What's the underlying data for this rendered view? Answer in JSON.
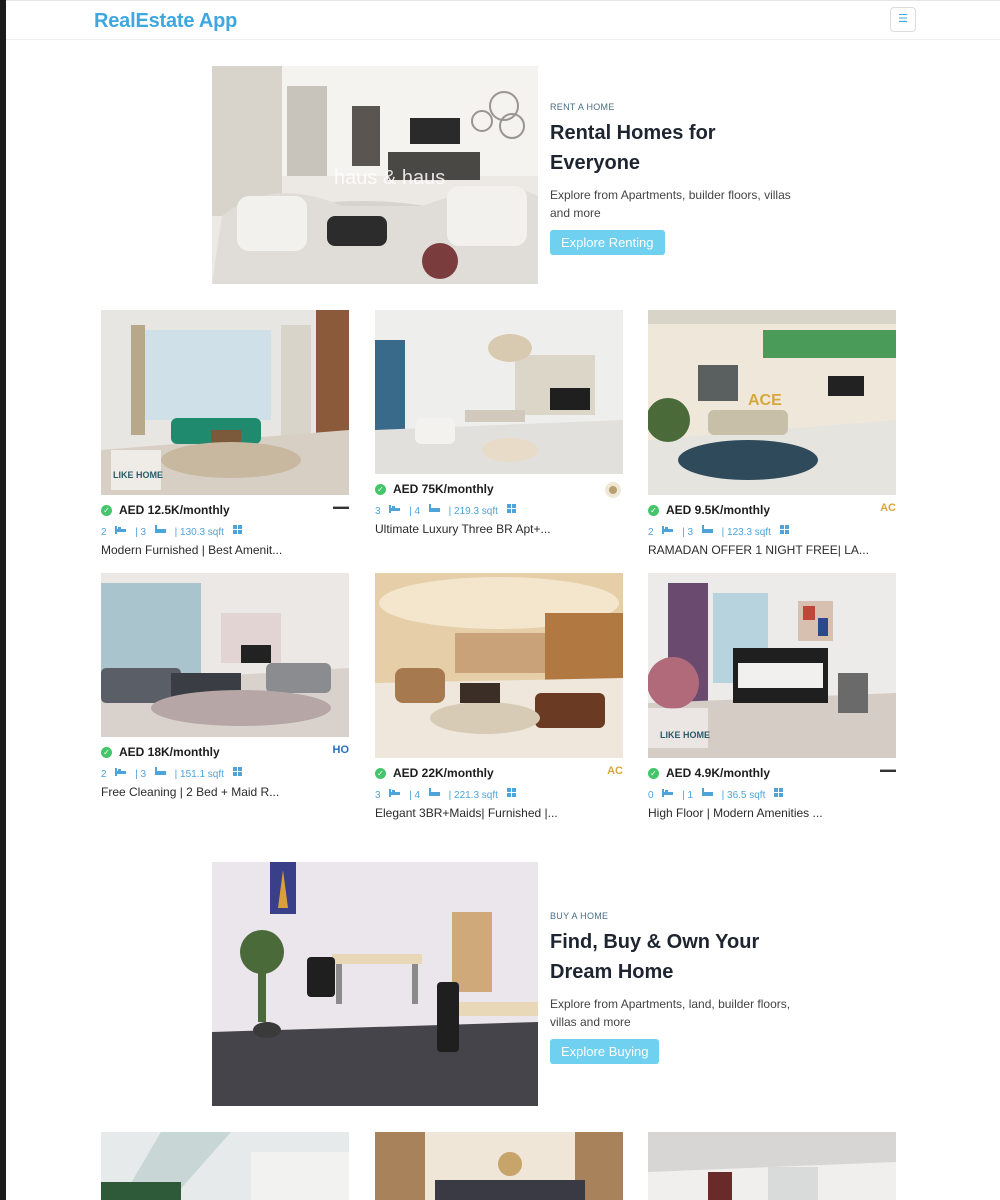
{
  "app": {
    "brand": "RealEstate App",
    "menu_icon": "hamburger-menu-icon"
  },
  "rent_section": {
    "eyebrow": "RENT A HOME",
    "title": "Rental Homes for Everyone",
    "description": "Explore from Apartments, builder floors, villas and more",
    "button": "Explore Renting",
    "image_watermark": "haus & haus"
  },
  "buy_section": {
    "eyebrow": "BUY A HOME",
    "title": "Find, Buy & Own Your Dream Home",
    "description": "Explore from Apartments, land, builder floors, villas and more",
    "button": "Explore Buying"
  },
  "listings": [
    {
      "price": "AED 12.5K/monthly",
      "beds": "2",
      "baths": "| 3",
      "area": "| 130.3 sqft",
      "title": "Modern Furnished | Best Amenit...",
      "agency_logo": "",
      "photo_watermark": "LIKE HOME"
    },
    {
      "price": "AED 75K/monthly",
      "beds": "3",
      "baths": "| 4",
      "area": "| 219.3 sqft",
      "title": "Ultimate Luxury Three BR Apt+...",
      "agency_logo": "",
      "photo_watermark": ""
    },
    {
      "price": "AED 9.5K/monthly",
      "beds": "2",
      "baths": "| 3",
      "area": "| 123.3 sqft",
      "title": "RAMADAN OFFER 1 NIGHT FREE| LA...",
      "agency_logo": "AC",
      "photo_watermark": "ACE"
    },
    {
      "price": "AED 18K/monthly",
      "beds": "2",
      "baths": "| 3",
      "area": "| 151.1 sqft",
      "title": "Free Cleaning | 2 Bed + Maid R...",
      "agency_logo": "HO",
      "photo_watermark": ""
    },
    {
      "price": "AED 22K/monthly",
      "beds": "3",
      "baths": "| 4",
      "area": "| 221.3 sqft",
      "title": "Elegant 3BR+Maids| Furnished |...",
      "agency_logo": "AC",
      "photo_watermark": ""
    },
    {
      "price": "AED 4.9K/monthly",
      "beds": "0",
      "baths": "| 1",
      "area": "| 36.5 sqft",
      "title": "High Floor | Modern Amenities ...",
      "agency_logo": "",
      "photo_watermark": "LIKE HOME"
    }
  ],
  "colors": {
    "brand": "#3ea7df",
    "button": "#6fd0f0",
    "verified": "#44c56a",
    "meta": "#4ea3d8"
  }
}
